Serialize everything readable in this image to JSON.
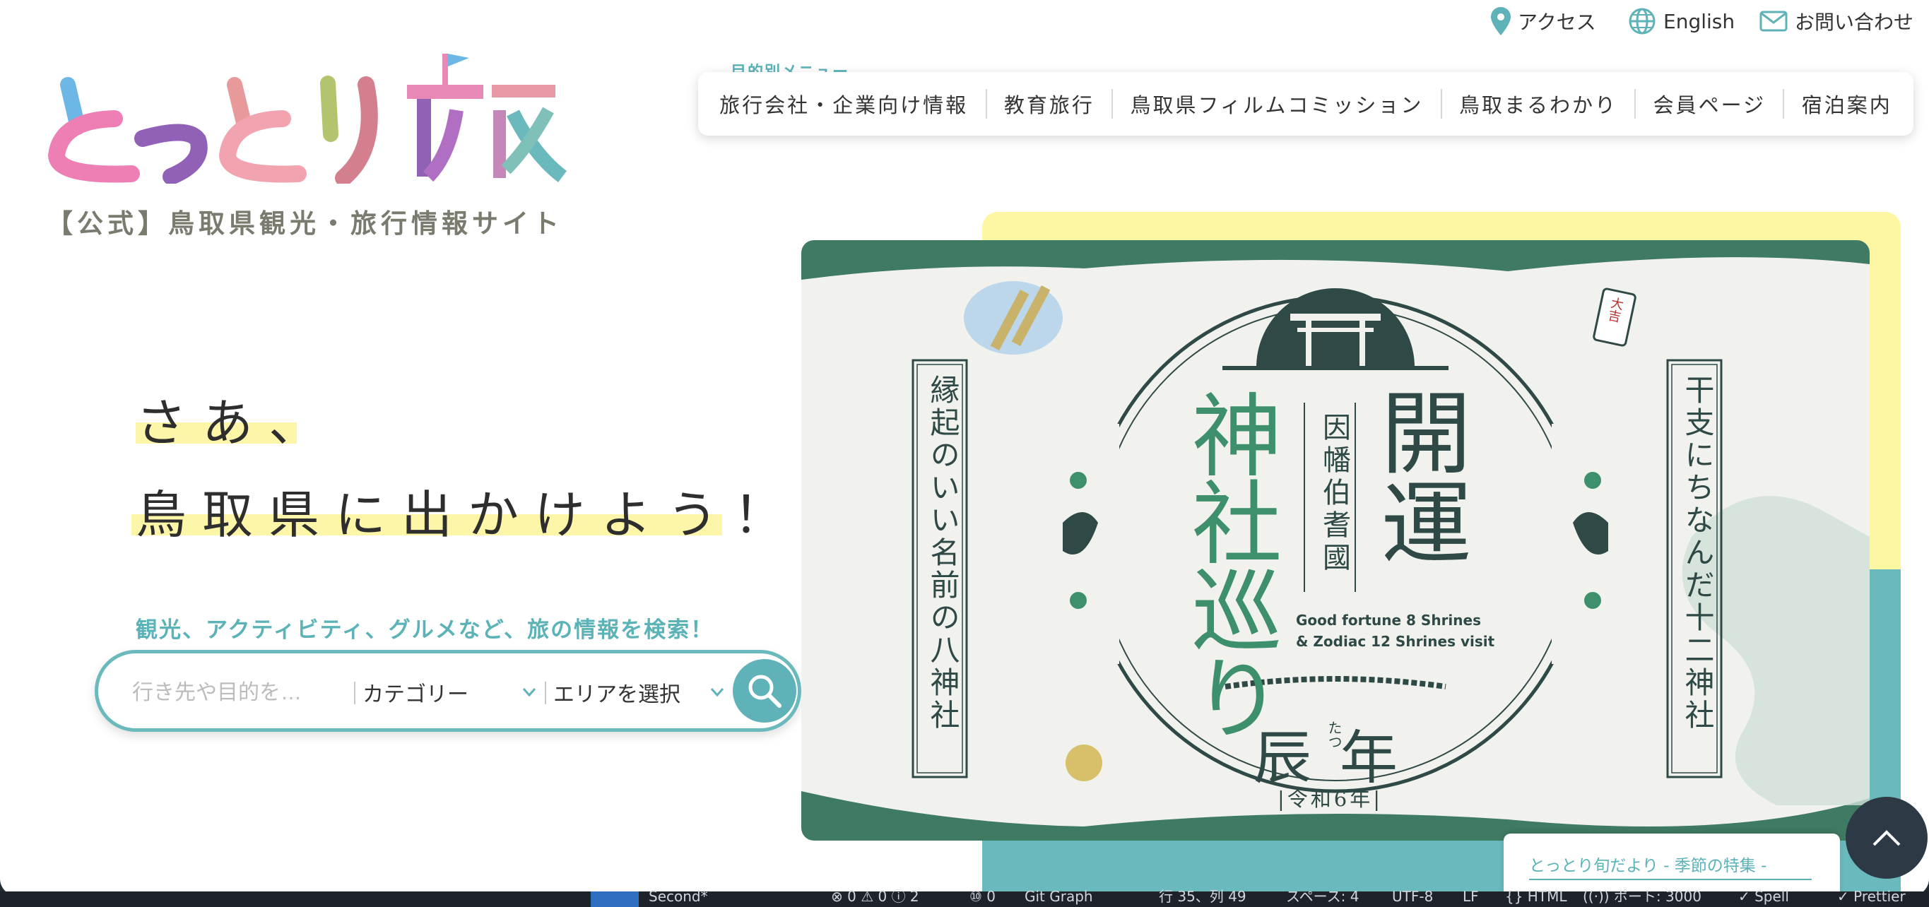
{
  "util_links": {
    "access": "アクセス",
    "english": "English",
    "contact": "お問い合わせ"
  },
  "logo": {
    "wordmark": "とっとり旅",
    "tagline": "【公式】鳥取県観光・旅行情報サイト"
  },
  "nav": {
    "label": "目的別メニュー",
    "items": [
      "旅行会社・企業向け情報",
      "教育旅行",
      "鳥取県フィルムコミッション",
      "鳥取まるわかり",
      "会員ページ",
      "宿泊案内"
    ]
  },
  "hero": {
    "line1": "さあ、",
    "line2": "鳥取県に出かけよう！"
  },
  "search": {
    "label": "観光、アクティビティ、グルメなど、旅の情報を検索！",
    "placeholder": "行き先や目的を…",
    "category": "カテゴリー",
    "area": "エリアを選択"
  },
  "banner": {
    "left_vertical": "縁起のいい名前の八神社",
    "right_vertical": "干支にちなんだ十二神社",
    "title_left": "神社巡り",
    "title_right": "開運",
    "center_vertical": "因幡伯耆國",
    "en_line1": "Good fortune 8 Shrines",
    "en_line2": "& Zodiac 12 Shrines visit",
    "year": "辰年",
    "ruby": "たつ",
    "era": "|令和6年|",
    "charm": "大吉"
  },
  "notice": "とっとり旬だより - 季節の特集 -",
  "statusbar": {
    "branch": "Second*",
    "problems": "⊗ 0 ⚠ 0 ⓘ 2",
    "ports": "⑩ 0",
    "git": "Git Graph",
    "position": "行 35、列 49",
    "spaces": "スペース: 4",
    "encoding": "UTF-8",
    "eol": "LF",
    "lang": "{} HTML",
    "port": "((·)) ポート: 3000",
    "spell": "✓ Spell",
    "prettier": "✓ Prettier"
  },
  "colors": {
    "teal": "#5fb3b8",
    "yellow": "#fdf7a4",
    "green_dark": "#2f4a46",
    "green": "#3e8f6b"
  }
}
